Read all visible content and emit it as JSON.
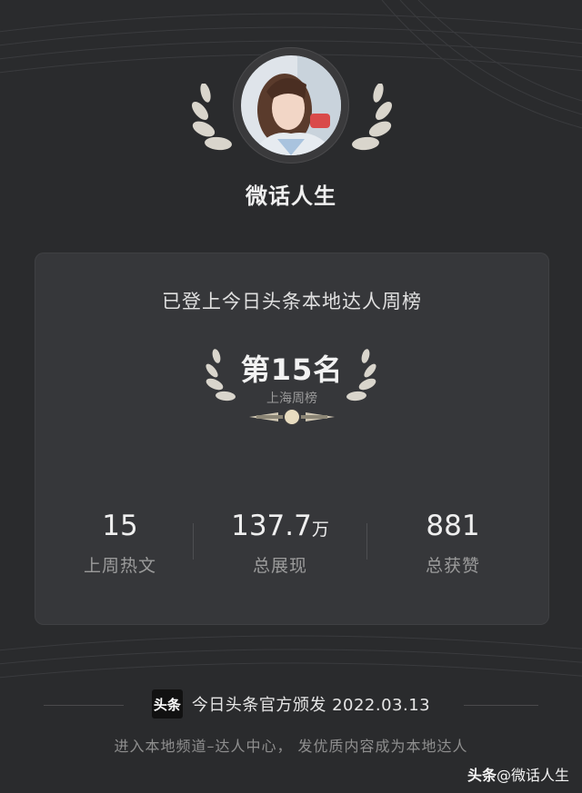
{
  "profile": {
    "username": "微话人生",
    "avatar_icon": "user-avatar-photo"
  },
  "card": {
    "title": "已登上今日头条本地达人周榜",
    "rank_label": "第15名",
    "rank_sub": "上海周榜",
    "stats": [
      {
        "value": "15",
        "unit": "",
        "label": "上周热文"
      },
      {
        "value": "137.7",
        "unit": "万",
        "label": "总展现"
      },
      {
        "value": "881",
        "unit": "",
        "label": "总获赞"
      }
    ]
  },
  "issuer": {
    "logo_text": "头条",
    "text": "今日头条官方颁发 2022.03.13"
  },
  "footer": {
    "text": "进入本地频道–达人中心， 发优质内容成为本地达人"
  },
  "watermark": {
    "brand": "头条",
    "author": "@微话人生"
  },
  "colors": {
    "background": "#2a2b2d",
    "card": "#36373a",
    "laurel": "#d9d5cc",
    "accent_gold": "#e8dcc0"
  }
}
